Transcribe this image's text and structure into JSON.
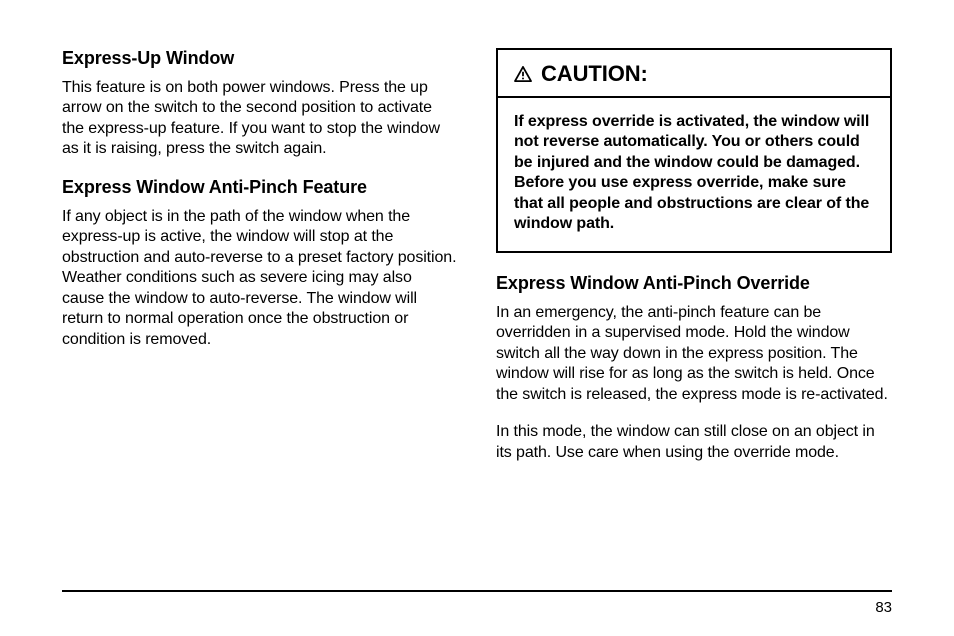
{
  "left": {
    "h1": "Express-Up Window",
    "p1": "This feature is on both power windows. Press the up arrow on the switch to the second position to activate the express-up feature. If you want to stop the window as it is raising, press the switch again.",
    "h2": "Express Window Anti-Pinch Feature",
    "p2": "If any object is in the path of the window when the express-up is active, the window will stop at the obstruction and auto-reverse to a preset factory position. Weather conditions such as severe icing may also cause the window to auto-reverse. The window will return to normal operation once the obstruction or condition is removed."
  },
  "right": {
    "caution_label": "CAUTION:",
    "caution_body": "If express override is activated, the window will not reverse automatically. You or others could be injured and the window could be damaged. Before you use express override, make sure that all people and obstructions are clear of the window path.",
    "h3": "Express Window Anti-Pinch Override",
    "p3": "In an emergency, the anti-pinch feature can be overridden in a supervised mode. Hold the window switch all the way down in the express position. The window will rise for as long as the switch is held. Once the switch is released, the express mode is re-activated.",
    "p4": "In this mode, the window can still close on an object in its path. Use care when using the override mode."
  },
  "page_number": "83"
}
